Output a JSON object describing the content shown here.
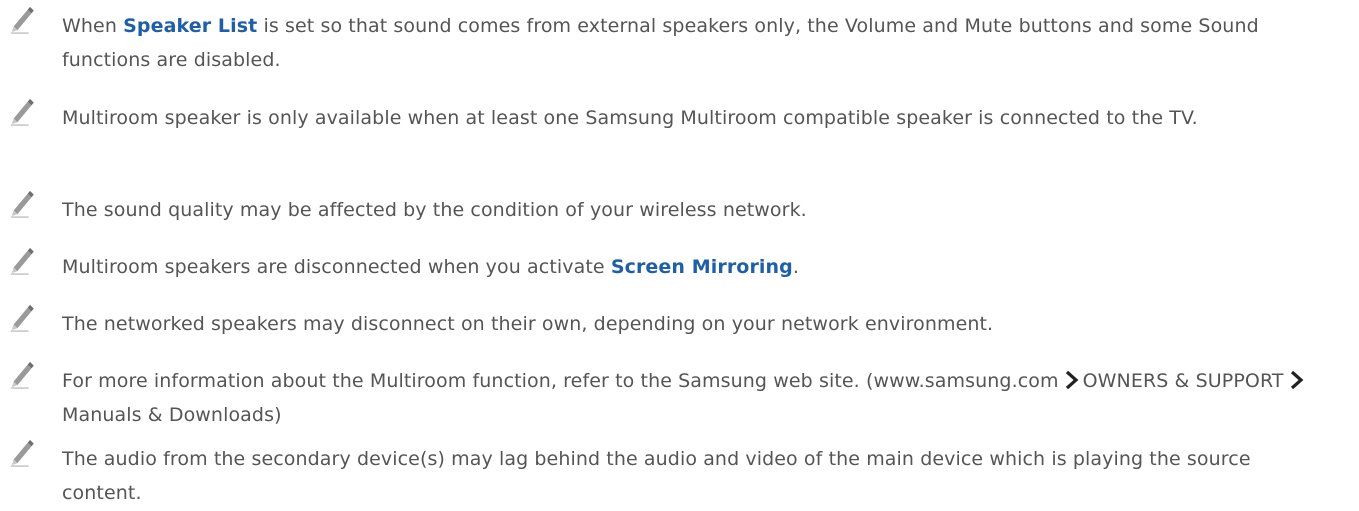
{
  "notes": [
    {
      "before": "When ",
      "highlight": "Speaker List",
      "after": " is set so that sound comes from external speakers only, the Volume and Mute buttons and some Sound functions are disabled."
    },
    {
      "text": "Multiroom speaker is only available when at least one Samsung Multiroom compatible speaker is connected to the TV."
    },
    {
      "text": "The sound quality may be affected by the condition of your wireless network."
    },
    {
      "before": "Multiroom speakers are disconnected when you activate ",
      "highlight": "Screen Mirroring",
      "after": "."
    },
    {
      "text": "The networked speakers may disconnect on their own, depending on your network environment."
    },
    {
      "part1": "For more information about the Multiroom function, refer to the Samsung web site. (www.samsung.com",
      "part2": "OWNERS & SUPPORT",
      "part3": "Manuals & Downloads)"
    },
    {
      "text": "The audio from the secondary device(s) may lag behind the audio and video of the main device which is playing the source content."
    }
  ],
  "icons": {
    "note": "pencil-icon",
    "separator": "chevron-right-icon"
  },
  "colors": {
    "text": "#555555",
    "highlight": "#1f5fa8",
    "icon": "#8a8a8a"
  }
}
